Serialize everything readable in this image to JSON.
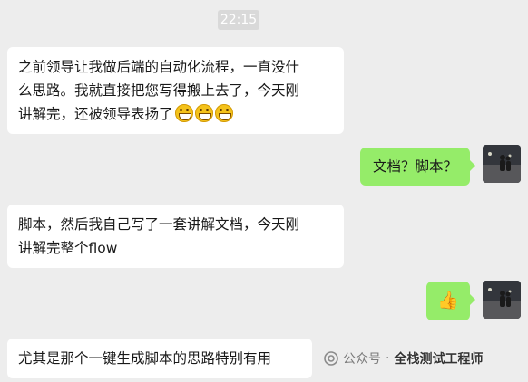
{
  "chat": {
    "timestamp": "22:15",
    "messages": [
      {
        "side": "in",
        "text": "之前领导让我做后端的自动化流程，一直没什\n么思路。我就直接把您写得搬上去了，今天刚\n讲解完，还被领导表扬了",
        "emoji": [
          "grin-emoji",
          "grin-emoji",
          "grin-emoji"
        ]
      },
      {
        "side": "out",
        "text": "文档？脚本？"
      },
      {
        "side": "in",
        "text": "脚本，然后我自己写了一套讲解文档，今天刚\n讲解完整个flow"
      },
      {
        "side": "out",
        "emoji": "thumbs-up-emoji"
      },
      {
        "side": "in",
        "text": "尤其是那个一键生成脚本的思路特别有用"
      }
    ]
  },
  "watermark": {
    "label": "公众号",
    "separator": "·",
    "name": "全栈测试工程师"
  },
  "colors": {
    "background": "#ededed",
    "incoming_bubble": "#ffffff",
    "outgoing_bubble": "#95ec69"
  }
}
